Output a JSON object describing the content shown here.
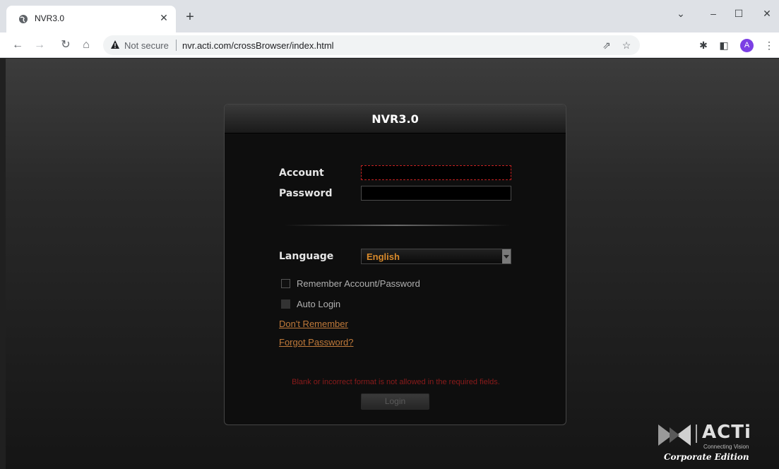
{
  "browser": {
    "tab_title": "NVR3.0",
    "security_label": "Not secure",
    "url": "nvr.acti.com/crossBrowser/index.html",
    "profile_initial": "A"
  },
  "login": {
    "title": "NVR3.0",
    "account_label": "Account",
    "password_label": "Password",
    "account_value": "",
    "password_value": "",
    "language_label": "Language",
    "language_value": "English",
    "remember_label": "Remember Account/Password",
    "auto_login_label": "Auto Login",
    "dont_remember_link": "Don't Remember",
    "forgot_password_link": "Forgot Password?",
    "error_message": "Blank or incorrect format is not allowed in the required fields.",
    "login_button": "Login"
  },
  "branding": {
    "brand": "ACTi",
    "tagline": "Connecting Vision",
    "edition": "Corporate Edition"
  },
  "colors": {
    "link": "#c07a3a",
    "language_value": "#d98a2b",
    "error": "#8b1b1b",
    "focus_border": "#c42121"
  }
}
